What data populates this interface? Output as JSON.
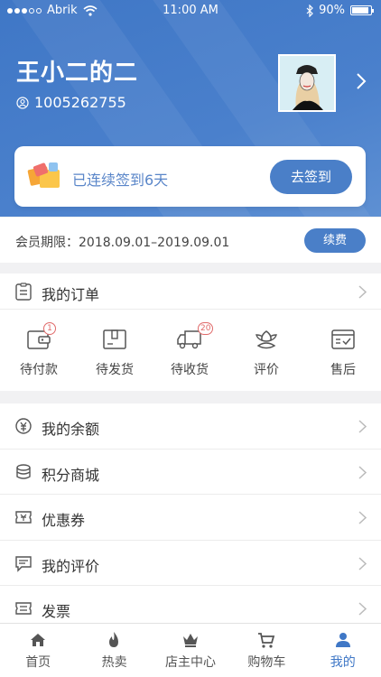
{
  "status": {
    "carrier": "Abrik",
    "time": "11:00 AM",
    "battery": "90%"
  },
  "profile": {
    "name": "王小二的二",
    "user_id": "1005262755"
  },
  "sign_in": {
    "text": "已连续签到6天",
    "button": "去签到"
  },
  "membership": {
    "text": "会员期限：2018.09.01–2019.09.01",
    "button": "续费"
  },
  "orders": {
    "title": "我的订单",
    "items": [
      {
        "label": "待付款",
        "badge": "1",
        "icon": "wallet-icon"
      },
      {
        "label": "待发货",
        "badge": "",
        "icon": "package-icon"
      },
      {
        "label": "待收货",
        "badge": "20",
        "icon": "truck-icon"
      },
      {
        "label": "评价",
        "badge": "",
        "icon": "flower-icon"
      },
      {
        "label": "售后",
        "badge": "",
        "icon": "after-sales-icon"
      }
    ]
  },
  "menu": [
    {
      "label": "我的余额",
      "icon": "balance-icon"
    },
    {
      "label": "积分商城",
      "icon": "points-icon"
    },
    {
      "label": "优惠券",
      "icon": "coupon-icon"
    },
    {
      "label": "我的评价",
      "icon": "review-icon"
    },
    {
      "label": "发票",
      "icon": "invoice-icon"
    }
  ],
  "tabs": [
    {
      "label": "首页",
      "icon": "home-icon"
    },
    {
      "label": "热卖",
      "icon": "flame-icon"
    },
    {
      "label": "店主中心",
      "icon": "crown-icon"
    },
    {
      "label": "购物车",
      "icon": "cart-icon"
    },
    {
      "label": "我的",
      "icon": "user-icon",
      "active": true
    }
  ],
  "colors": {
    "primary": "#4a7fc8",
    "badge": "#e06a6a",
    "background": "#f1f1f3"
  }
}
